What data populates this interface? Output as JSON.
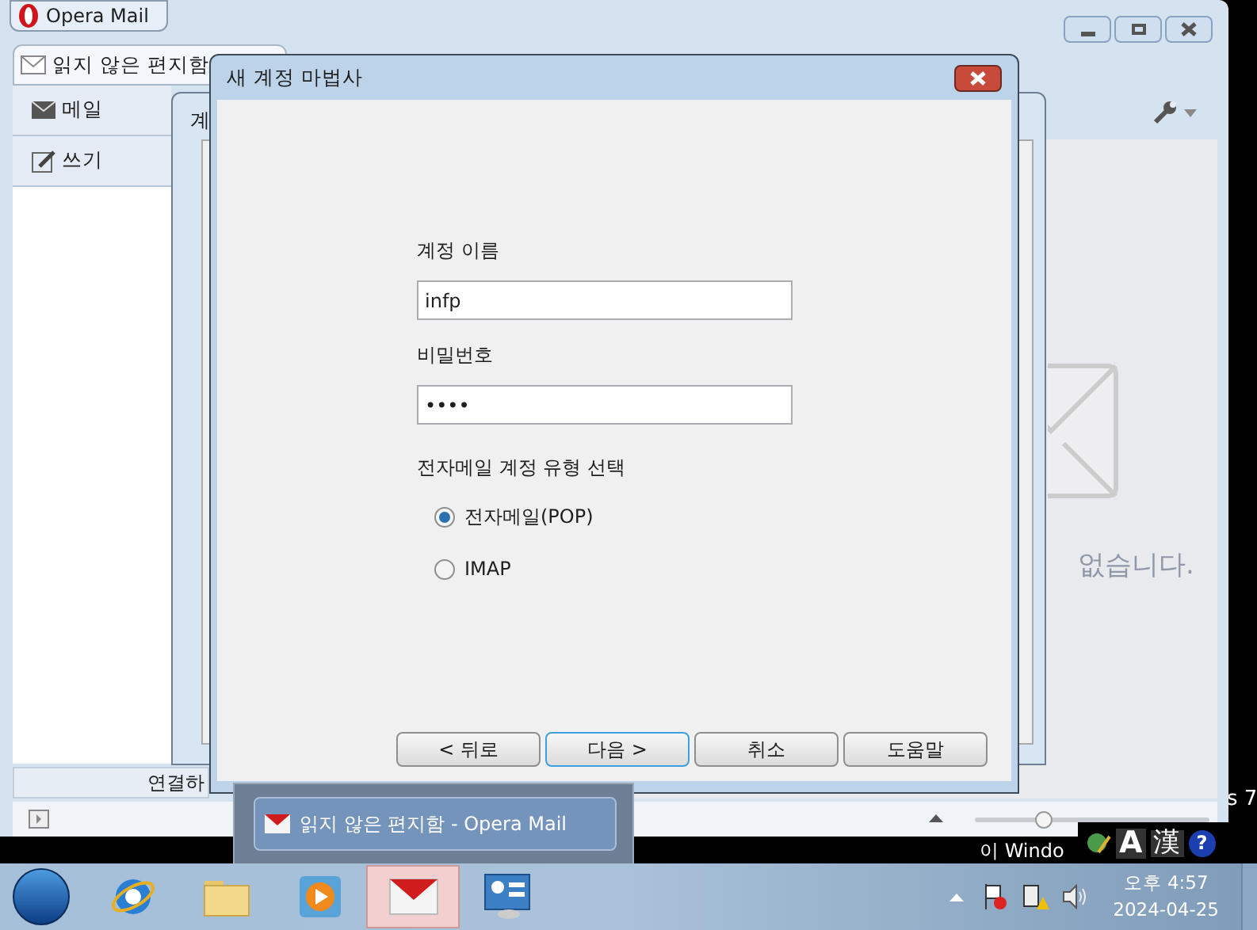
{
  "app": {
    "menu_button": "Opera Mail",
    "tab": {
      "label": "읽지 않은 편지함",
      "selected": true
    },
    "sidebar": [
      {
        "label": "메일",
        "kind": "mail"
      },
      {
        "label": "쓰기",
        "kind": "compose"
      }
    ],
    "connect_bar": "연결하",
    "empty_message": "없습니다."
  },
  "back_dialog": {
    "title": "계"
  },
  "wizard": {
    "title": "새 계정 마법사",
    "fields": [
      {
        "label": "계정 이름",
        "value": "infp"
      },
      {
        "label": "비밀번호",
        "value": "••••"
      }
    ],
    "account_type_label": "전자메일 계정 유형 선택",
    "account_types": [
      {
        "label": "전자메일(POP)",
        "selected": true
      },
      {
        "label": "IMAP",
        "selected": false
      }
    ],
    "buttons": [
      {
        "label": "< 뒤로",
        "focused": false
      },
      {
        "label": "다음 >",
        "focused": true
      },
      {
        "label": "취소",
        "focused": false
      },
      {
        "label": "도움말",
        "focused": false
      }
    ]
  },
  "taskbar_preview": {
    "label": "읽지 않은 편지함 - Opera Mail"
  },
  "zoom_slider": {
    "level": 0.28
  },
  "background_text": [
    "s 7",
    "이 Windo"
  ],
  "language_bar": [
    "A",
    "漢",
    "?"
  ],
  "taskbar_apps": [
    {
      "kind": "browser",
      "active": false
    },
    {
      "kind": "folder",
      "active": false
    },
    {
      "kind": "media",
      "active": false
    },
    {
      "kind": "mail",
      "active": true
    },
    {
      "kind": "panel",
      "active": false
    }
  ],
  "clock": {
    "time": "오후 4:57",
    "date": "2024-04-25"
  }
}
